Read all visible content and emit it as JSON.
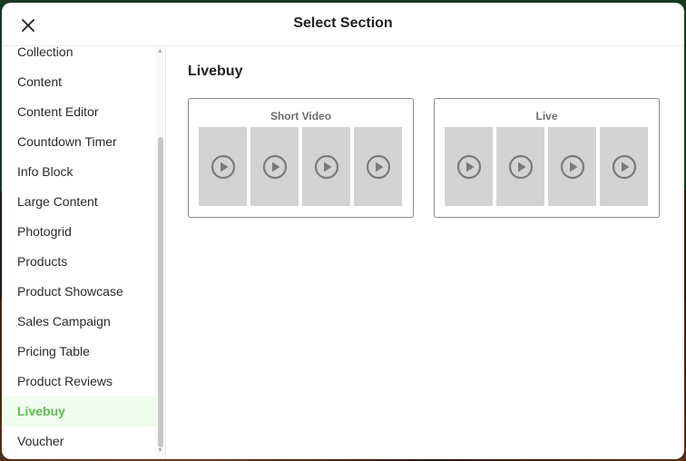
{
  "modal": {
    "title": "Select Section"
  },
  "sidebar": {
    "items": [
      {
        "label": "Collection",
        "active": false
      },
      {
        "label": "Content",
        "active": false
      },
      {
        "label": "Content Editor",
        "active": false
      },
      {
        "label": "Countdown Timer",
        "active": false
      },
      {
        "label": "Info Block",
        "active": false
      },
      {
        "label": "Large Content",
        "active": false
      },
      {
        "label": "Photogrid",
        "active": false
      },
      {
        "label": "Products",
        "active": false
      },
      {
        "label": "Product Showcase",
        "active": false
      },
      {
        "label": "Sales Campaign",
        "active": false
      },
      {
        "label": "Pricing Table",
        "active": false
      },
      {
        "label": "Product Reviews",
        "active": false
      },
      {
        "label": "Livebuy",
        "active": true
      },
      {
        "label": "Voucher",
        "active": false
      }
    ]
  },
  "main": {
    "heading": "Livebuy",
    "cards": [
      {
        "title": "Short Video",
        "tile_icon": "play-circle-icon"
      },
      {
        "title": "Live",
        "tile_icon": "play-circle-icon"
      }
    ]
  },
  "colors": {
    "accent": "#5cc24f",
    "active_bg": "#f1fbef",
    "tile": "#d3d3d3",
    "play_icon": "#7a7a7a"
  }
}
